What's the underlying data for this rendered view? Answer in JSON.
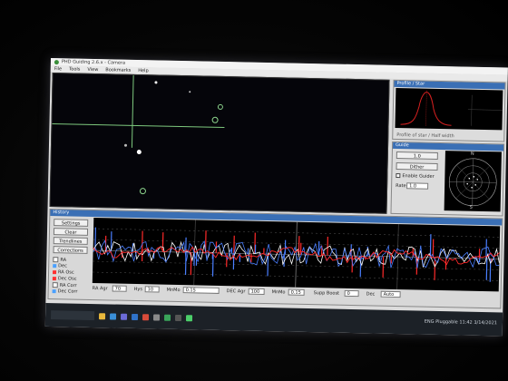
{
  "window": {
    "title": "PHD Guiding 2.6.x - Camera"
  },
  "menu": {
    "items": [
      "File",
      "Tools",
      "View",
      "Bookmarks",
      "Help"
    ]
  },
  "profile_panel": {
    "title": "Profile / Star",
    "caption": "Profile of star / Half width"
  },
  "guide_panel": {
    "title": "Guide",
    "btn1": "1.0",
    "btn2": "Dither",
    "check_label": "Enable Guider",
    "field_label": "Rate",
    "field_value": "1.0",
    "polar_top": "N",
    "polar_bottom": "S"
  },
  "graph_panel": {
    "title": "History",
    "buttons": [
      "Settings",
      "Clear",
      "Trendlines",
      "Corrections"
    ],
    "legend": [
      {
        "label": "RA",
        "color": "#ffffff"
      },
      {
        "label": "Dec",
        "color": "#4aa0ff"
      },
      {
        "label": "RA Osc",
        "color": "#ff3030"
      },
      {
        "label": "Dec Osc",
        "color": "#ff3030"
      },
      {
        "label": "RA Corr",
        "color": "#ffffff"
      },
      {
        "label": "Dec Corr",
        "color": "#4aa0ff"
      }
    ],
    "controls": [
      {
        "label": "RA Agr",
        "value": "70"
      },
      {
        "label": "Hys",
        "value": "10"
      },
      {
        "label": "MnMo",
        "value": "0.15"
      },
      {
        "label": "DEC Agr",
        "value": "100"
      },
      {
        "label": "MnMo",
        "value": "0.15"
      },
      {
        "label": "Supp Boost",
        "value": "0"
      },
      {
        "label": "Dec",
        "value": "Auto"
      }
    ],
    "series_colors": {
      "ra": "#ffffff",
      "dec": "#4a7fff",
      "ra_corr": "#ff2a2a",
      "dec_corr": "#ff2a2a"
    }
  },
  "taskbar": {
    "tray_text": "ENG  Pluggable  11:42  3/14/2021"
  },
  "colors": {
    "crosshair": "#7ec97e",
    "star_ring": "#8fd88f",
    "panel_title": "#3a6fb5",
    "profile_curve": "#d62020"
  }
}
